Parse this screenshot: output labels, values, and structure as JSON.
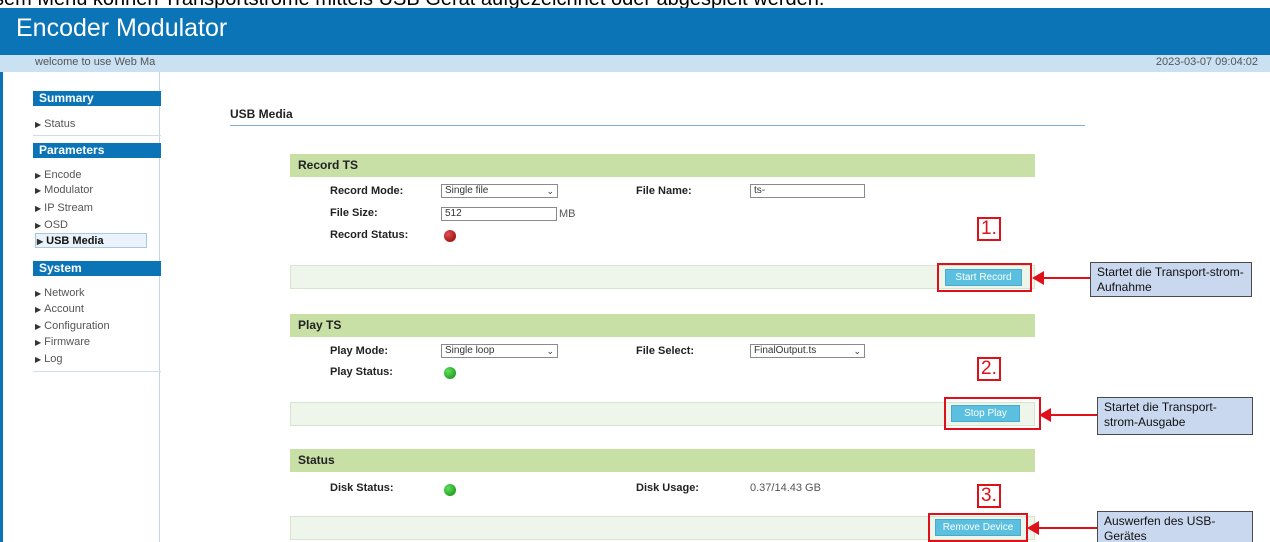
{
  "caption": "sem Menü können Transportströme mittels USB Gerät aufgezeichnet oder abgespielt werden.",
  "header": {
    "title": "Encoder Modulator"
  },
  "welcome": {
    "text": "welcome to use Web Ma",
    "datetime": "2023-03-07 09:04:02"
  },
  "sidebar": {
    "summary_label": "Summary",
    "status_label": "Status",
    "parameters_label": "Parameters",
    "encode_label": "Encode",
    "modulator_label": "Modulator",
    "ipstream_label": "IP Stream",
    "osd_label": "OSD",
    "usbmedia_label": "USB Media",
    "system_label": "System",
    "network_label": "Network",
    "account_label": "Account",
    "configuration_label": "Configuration",
    "firmware_label": "Firmware",
    "log_label": "Log"
  },
  "page": {
    "title": "USB Media"
  },
  "record": {
    "section_title": "Record TS",
    "mode_label": "Record Mode:",
    "mode_value": "Single file",
    "filename_label": "File Name:",
    "filename_value": "ts-",
    "filesize_label": "File Size:",
    "filesize_value": "512",
    "filesize_unit": "MB",
    "status_label": "Record Status:",
    "status_color": "#b01010",
    "button_label": "Start Record"
  },
  "play": {
    "section_title": "Play TS",
    "mode_label": "Play Mode:",
    "mode_value": "Single loop",
    "fileselect_label": "File Select:",
    "fileselect_value": "FinalOutput.ts",
    "status_label": "Play Status:",
    "status_color": "#1a9a1a",
    "button_label": "Stop Play"
  },
  "status": {
    "section_title": "Status",
    "disk_status_label": "Disk Status:",
    "disk_status_color": "#1a9a1a",
    "disk_usage_label": "Disk Usage:",
    "disk_usage_value": "0.37/14.43 GB",
    "button_label": "Remove Device"
  },
  "annotations": {
    "marker1": "1.",
    "marker2": "2.",
    "marker3": "3.",
    "callout1": "Startet die Transport-strom-Aufnahme",
    "callout2": "Startet die Transport-strom-Ausgabe",
    "callout3": "Auswerfen des USB-Gerätes"
  },
  "colors": {
    "header_blue": "#0a74b6",
    "section_green": "#c8e0a6",
    "button_blue": "#5bbfe0",
    "annotation_red": "#e0101a",
    "callout_bg": "#c9d8ee"
  }
}
